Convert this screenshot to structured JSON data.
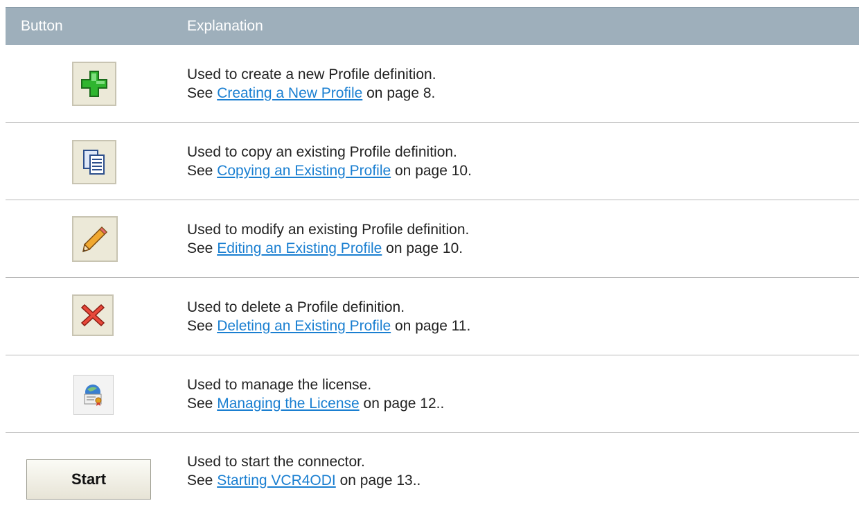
{
  "header": {
    "col_button": "Button",
    "col_explanation": "Explanation"
  },
  "rows": [
    {
      "icon": "add-plus-icon",
      "line1": "Used to create a new Profile definition.",
      "see": "See ",
      "link": "Creating a New Profile",
      "after": " on page 8."
    },
    {
      "icon": "copy-documents-icon",
      "line1": "Used to copy an existing Profile definition.",
      "see": "See ",
      "link": "Copying an Existing Profile",
      "after": " on page 10."
    },
    {
      "icon": "pencil-edit-icon",
      "line1": "Used to modify an existing Profile definition.",
      "see": "See ",
      "link": "Editing an Existing Profile",
      "after": " on page 10."
    },
    {
      "icon": "delete-x-icon",
      "line1": "Used to delete a Profile definition.",
      "see": "See ",
      "link": "Deleting an Existing Profile",
      "after": " on page 11."
    },
    {
      "icon": "license-certificate-icon",
      "line1": "Used to manage the license.",
      "see": "See ",
      "link": "Managing the License",
      "after": " on page 12.."
    },
    {
      "icon": "start-button",
      "button_label": "Start",
      "line1": "Used to start the connector.",
      "see": "See ",
      "link": "Starting VCR4ODI",
      "after": " on page 13.."
    }
  ]
}
